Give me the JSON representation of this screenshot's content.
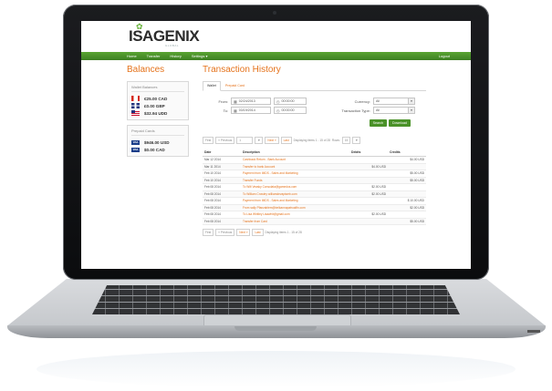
{
  "brand": {
    "logo": "ISAGENIX",
    "tagline": "GLOBAL"
  },
  "nav": {
    "items": [
      "Home",
      "Transfer",
      "History",
      "Settings ▾"
    ],
    "logout": "Logout"
  },
  "sidebar": {
    "title": "Balances",
    "wallet": {
      "title": "Wallet Balances",
      "items": [
        {
          "flag": "canada-flag-icon",
          "amount": "€25.00 CAD"
        },
        {
          "flag": "uk-flag-icon",
          "amount": "£0.00 GBP"
        },
        {
          "flag": "us-flag-icon",
          "amount": "$32.94 UDD"
        }
      ]
    },
    "prepaid": {
      "title": "Prepaid Cards",
      "items": [
        {
          "card": "VISA",
          "amount": "$946.00 USD"
        },
        {
          "card": "VISA",
          "amount": "$0.00 CAD"
        }
      ]
    }
  },
  "main": {
    "title": "Transaction History",
    "tabs": [
      "Wallet",
      "Prepaid Card"
    ],
    "filters": {
      "from_label": "From:",
      "from_date": "02/24/2013",
      "from_time": "00:00:00",
      "to_label": "To:",
      "to_date": "03/19/2014",
      "to_time": "00:00:00",
      "currency_label": "Currency:",
      "currency_value": "All",
      "type_label": "Transaction Type:",
      "type_value": "All"
    },
    "buttons": {
      "search": "Search",
      "download": "Download"
    },
    "pager_top": {
      "first": "First",
      "previous": "« Previous",
      "page": "1",
      "next": "Next »",
      "last": "Last",
      "info": "Displaying items 1 - 15 of 28",
      "rows_label": "Rows:",
      "rows_value": "15"
    },
    "table": {
      "headers": [
        "Date",
        "Description",
        "Debits",
        "Credits"
      ],
      "rows": [
        [
          "Mar 12 2014",
          "Cashback Return - Bank Account",
          "",
          "$4.00 USD"
        ],
        [
          "Mar 11 2014",
          "Transfer to bank Account",
          "$4.00 USD",
          ""
        ],
        [
          "Feb 10 2014",
          "Payment from IMDS - Sales and Marketing",
          "",
          "$5.00 USD"
        ],
        [
          "Feb 10 2014",
          "Transfer Funds",
          "",
          "$5.00 USD"
        ],
        [
          "Feb 08 2014",
          "To Wilt Veasky Consolata@gamedos.com",
          "$2.00 USD",
          ""
        ],
        [
          "Feb 08 2014",
          "To William Crowley williamdevaptweb.com",
          "$2.00 USD",
          ""
        ],
        [
          "Feb 08 2014",
          "Payment from IMDS - Sales and Marketing",
          "",
          "$ 10.00 USD"
        ],
        [
          "Feb 08 2014",
          "From sally Pfanzablem@belkannapatrualfin.com",
          "",
          "$2.00 USD"
        ],
        [
          "Feb 08 2014",
          "To Lisa Whitley Lisawhit@gmail.com",
          "$2.00 USD",
          ""
        ],
        [
          "Feb 08 2014",
          "Transfer from Card",
          "",
          "$5.00 USD"
        ]
      ]
    },
    "pager_bottom": {
      "first": "First",
      "previous": "« Previous",
      "next": "Next »",
      "last": "Last",
      "info": "Displaying items 1 - 15 of 28"
    }
  }
}
